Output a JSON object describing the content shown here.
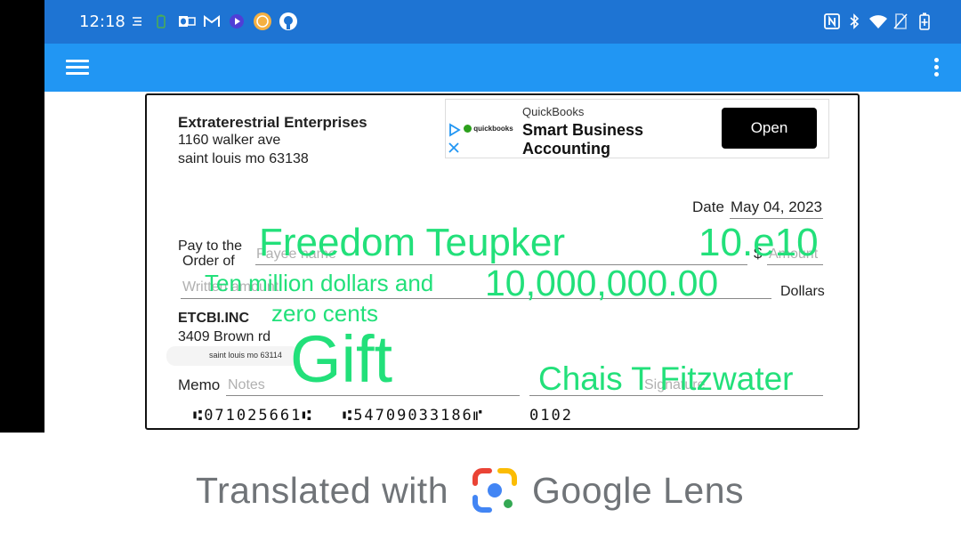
{
  "status_bar": {
    "time": "12:18",
    "left_icons": [
      "stream-icon",
      "battery-saver-icon",
      "outlook-icon",
      "gmail-icon",
      "media-icon",
      "coin-icon",
      "github-icon"
    ],
    "right_icons": [
      "nfc-icon",
      "bluetooth-icon",
      "wifi-icon",
      "no-sim-icon",
      "battery-icon"
    ]
  },
  "app_bar": {
    "menu_icon": "hamburger-menu-icon",
    "overflow_icon": "more-vert-icon"
  },
  "check": {
    "payer": {
      "name": "Extraterestrial Enterprises",
      "address_line1": "1160 walker ave",
      "address_line2": "saint louis mo 63138"
    },
    "ad": {
      "brand": "QuickBooks",
      "headline_line1": "Smart Business",
      "headline_line2": "Accounting",
      "open_label": "Open",
      "logo_text": "quickbooks"
    },
    "date_label": "Date",
    "date_value": "May 04, 2023",
    "pay_to_label_line1": "Pay to the",
    "pay_to_label_line2": "Order of",
    "payee_placeholder": "Payee name",
    "dollar_sign": "$",
    "amount_placeholder": "Amount",
    "written_placeholder": "Written amount",
    "dollars_label": "Dollars",
    "bank": {
      "name": "ETCBI.INC",
      "address_line1": "3409 Brown rd",
      "address_line2": "saint louis mo 63114"
    },
    "memo_label": "Memo",
    "notes_placeholder": "Notes",
    "signature_placeholder": "Signature",
    "micr": {
      "routing": "⑆071025661⑆",
      "account": "⑆54709033186⑈",
      "check_number": "0102"
    },
    "overlay": {
      "payee": "Freedom Teupker",
      "amount_short": "10.e10",
      "written_line1": "Ten million dollars and",
      "written_line2": "zero cents",
      "amount_numeric": "10,000,000.00",
      "memo": "Gift",
      "signature": "Chais T Fitzwater"
    }
  },
  "footer": {
    "text_left": "Translated with",
    "text_right": "Google Lens"
  },
  "colors": {
    "status_bar": "#1e74d3",
    "app_bar": "#2196f3",
    "overlay_text": "#22e07a"
  }
}
